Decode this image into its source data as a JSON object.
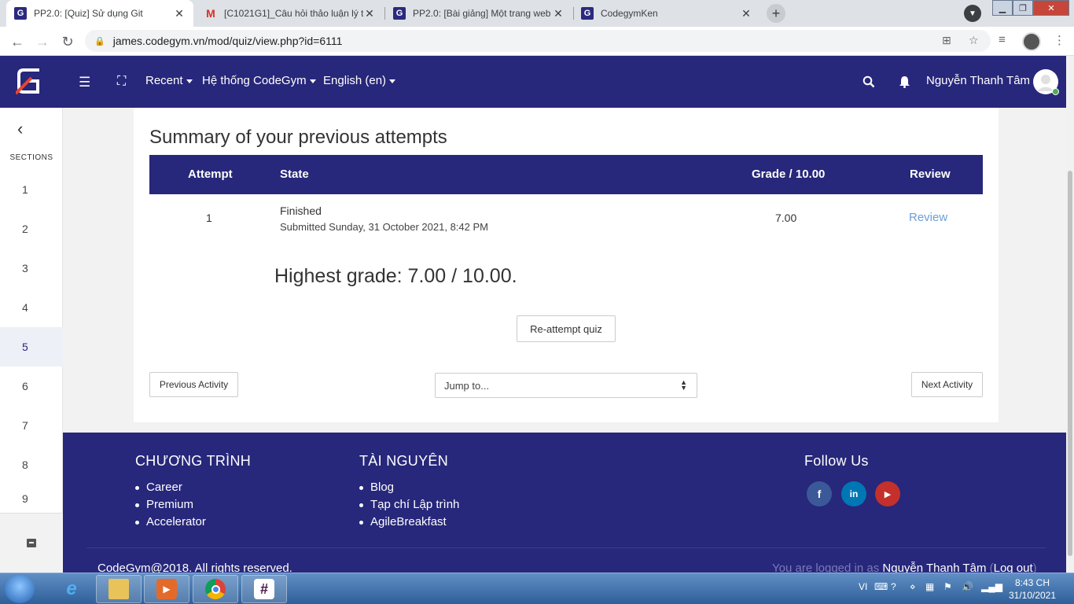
{
  "browser": {
    "tabs": [
      {
        "title": "PP2.0: [Quiz] Sử dụng Git",
        "favicon": "codegym-favicon",
        "active": true
      },
      {
        "title": "[C1021G1]_Câu hỏi thảo luận lý t",
        "favicon": "gmail-favicon",
        "active": false
      },
      {
        "title": "PP2.0: [Bài giảng] Một trang web",
        "favicon": "codegym-favicon",
        "active": false
      },
      {
        "title": "CodegymKen",
        "favicon": "codegym-favicon",
        "active": false
      }
    ],
    "url": "james.codegym.vn/mod/quiz/view.php?id=6111"
  },
  "navbar": {
    "recent": "Recent",
    "system": "Hệ thống CodeGym",
    "language": "English (en)",
    "user_name": "Nguyễn Thanh Tâm",
    "brand_color": "#27277b"
  },
  "drawer": {
    "sections_label": "SECTIONS",
    "items": [
      "1",
      "2",
      "3",
      "4",
      "5",
      "6",
      "7",
      "8",
      "9"
    ],
    "active_item": "5"
  },
  "quiz": {
    "summary_title": "Summary of your previous attempts",
    "table": {
      "headers": {
        "attempt": "Attempt",
        "state": "State",
        "grade": "Grade / 10.00",
        "review": "Review"
      },
      "rows": [
        {
          "attempt": "1",
          "state": "Finished",
          "submitted": "Submitted Sunday, 31 October 2021, 8:42 PM",
          "grade": "7.00",
          "review": "Review"
        }
      ]
    },
    "highest_grade": "Highest grade: 7.00 / 10.00.",
    "reattempt": "Re-attempt quiz",
    "previous_activity": "Previous Activity",
    "jump_to": "Jump to...",
    "next_activity": "Next Activity"
  },
  "footer": {
    "chuong_trinh": {
      "title": "CHƯƠNG TRÌNH",
      "items": [
        "Career",
        "Premium",
        "Accelerator"
      ]
    },
    "tai_nguyen": {
      "title": "TÀI NGUYÊN",
      "items": [
        "Blog",
        "Tạp chí Lập trình",
        "AgileBreakfast"
      ]
    },
    "follow": {
      "title": "Follow Us",
      "social": [
        {
          "name": "facebook-icon",
          "glyph": "f",
          "color": "#3b5998"
        },
        {
          "name": "linkedin-icon",
          "glyph": "in",
          "color": "#0077b5"
        },
        {
          "name": "youtube-icon",
          "glyph": "▶",
          "color": "#c4302b"
        }
      ]
    },
    "copyright": "CodeGym@2018. All rights reserved.",
    "logged_in_prefix": "You are logged in as",
    "logged_in_user": "Nguyễn Thanh Tâm",
    "logout": "Log out"
  },
  "taskbar": {
    "language": "VI",
    "time": "8:43 CH",
    "date": "31/10/2021"
  }
}
